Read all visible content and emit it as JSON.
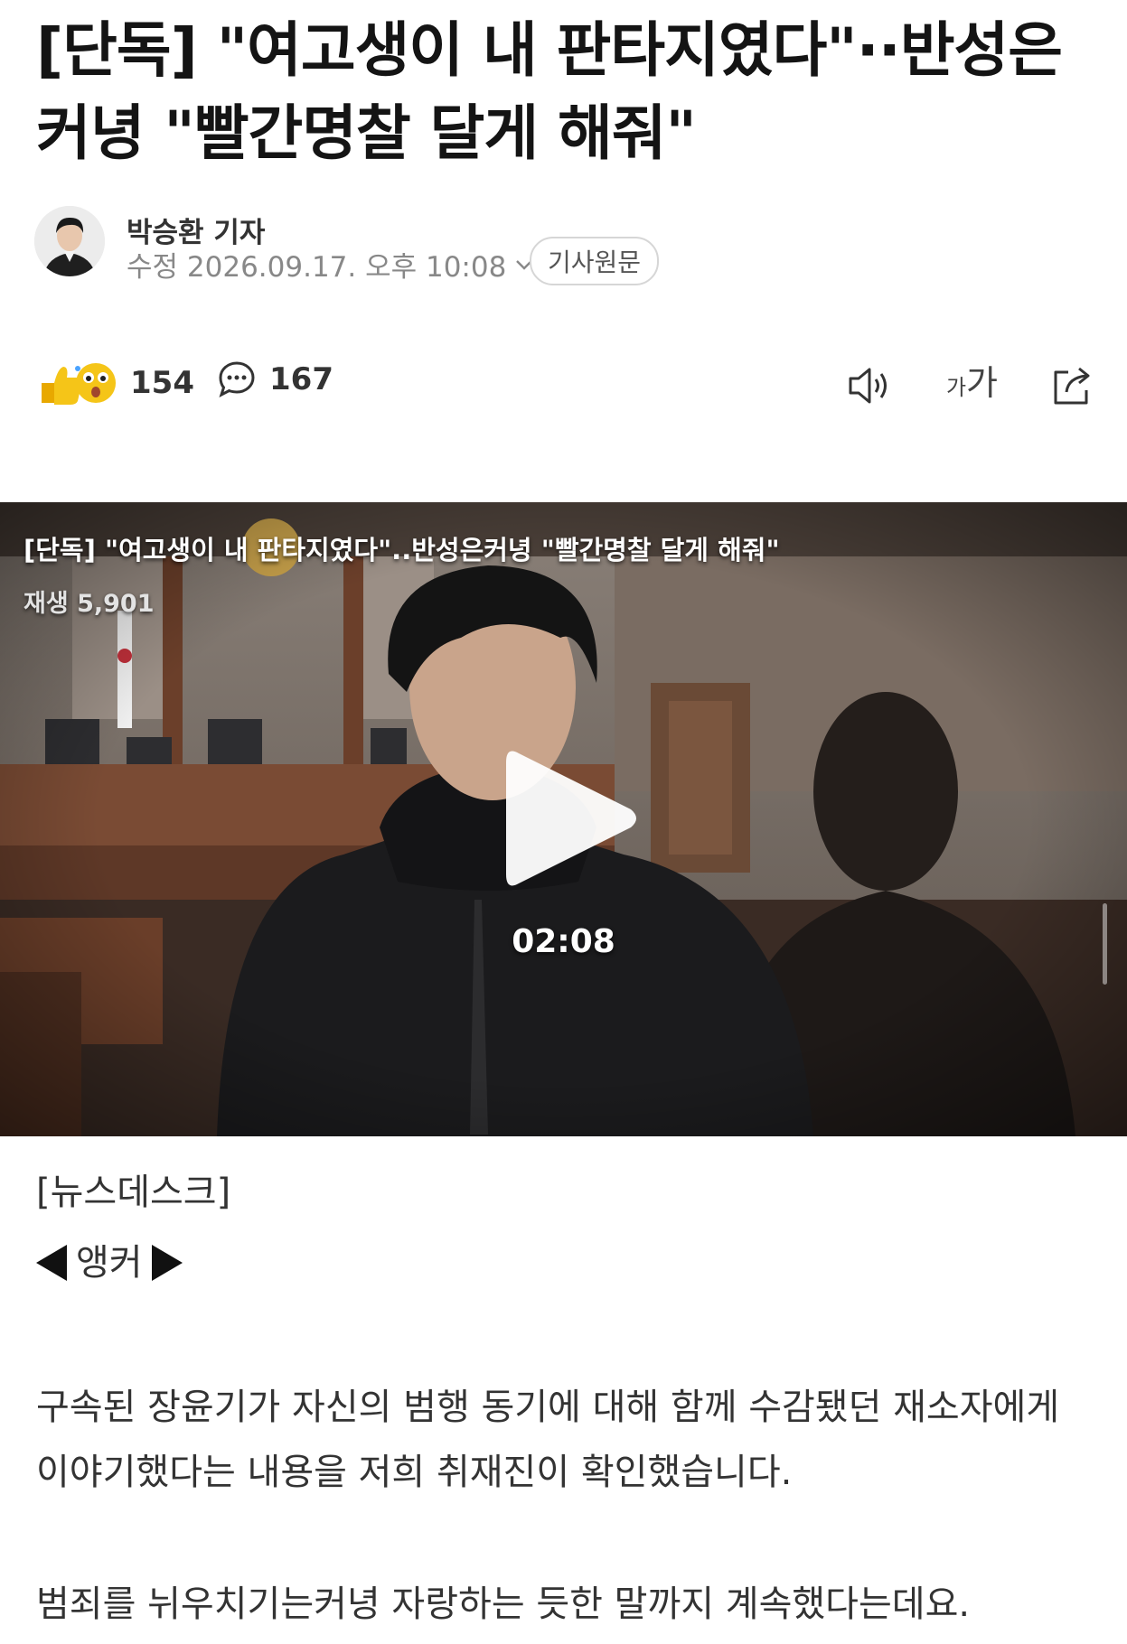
{
  "article": {
    "headline": "[단독] \"여고생이 내 판타지였다\"··반성은 커녕 \"빨간명찰 달게 해줘\"",
    "author": "박승환 기자",
    "modified_label": "수정 2026.09.17. 오후 10:08",
    "source_button": "기사원문"
  },
  "toolbar": {
    "reaction_count": "154",
    "comment_count": "167",
    "icons": [
      "reaction-emoji-icon",
      "comment-bubble-icon",
      "speaker-icon",
      "font-size-icon",
      "share-icon"
    ],
    "font_size_small": "가",
    "font_size_large": "가"
  },
  "video": {
    "title": "[단독] \"여고생이 내 판타지였다\"..반성은커녕 \"빨간명찰 달게 해줘\"",
    "views": "재생 5,901",
    "duration": "02:08"
  },
  "body": {
    "section_tag": "[뉴스데스크]",
    "anchor_label": "앵커",
    "paragraphs": [
      "구속된 장윤기가 자신의 범행 동기에 대해 함께 수감됐던 재소자에게 이야기했다는 내용을 저희 취재진이 확인했습니다.",
      "범죄를 뉘우치기는커녕 자랑하는 듯한 말까지 계속했다는데요."
    ]
  },
  "colors": {
    "text": "#141414",
    "meta": "#888888",
    "reaction_yellow": "#f5c518"
  }
}
